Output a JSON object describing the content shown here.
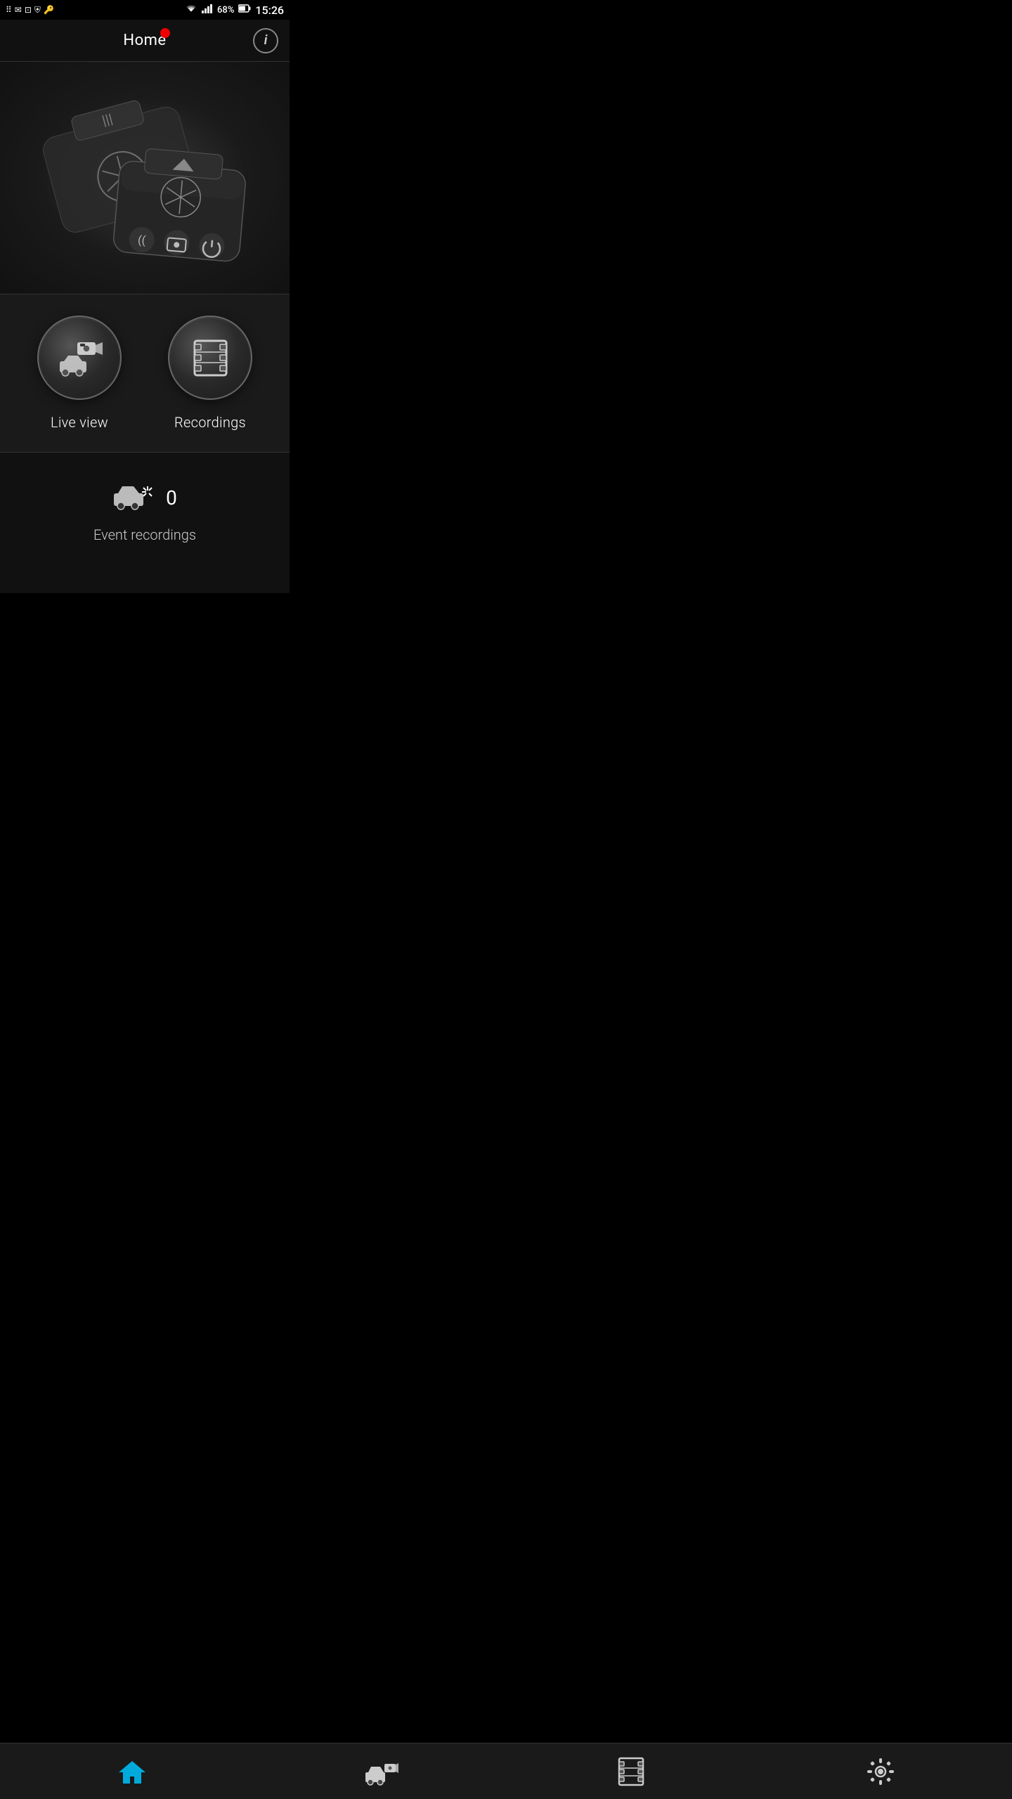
{
  "statusBar": {
    "left_icons": [
      "dots-icon",
      "gmail-icon",
      "overlay-icon",
      "shield-icon",
      "key-icon"
    ],
    "wifi": "wifi",
    "signal": "signal",
    "battery": "68%",
    "time": "15:26"
  },
  "header": {
    "title": "Home",
    "infoButton": "i",
    "recordingDot": true
  },
  "mainButtons": {
    "liveView": {
      "label": "Live view",
      "icon": "live-view-icon"
    },
    "recordings": {
      "label": "Recordings",
      "icon": "recordings-icon"
    }
  },
  "eventsSection": {
    "count": "0",
    "label": "Event recordings"
  },
  "bottomNav": {
    "items": [
      {
        "id": "home",
        "label": "home",
        "active": true
      },
      {
        "id": "live",
        "label": "live",
        "active": false
      },
      {
        "id": "recordings",
        "label": "recordings",
        "active": false
      },
      {
        "id": "settings",
        "label": "settings",
        "active": false
      }
    ]
  }
}
